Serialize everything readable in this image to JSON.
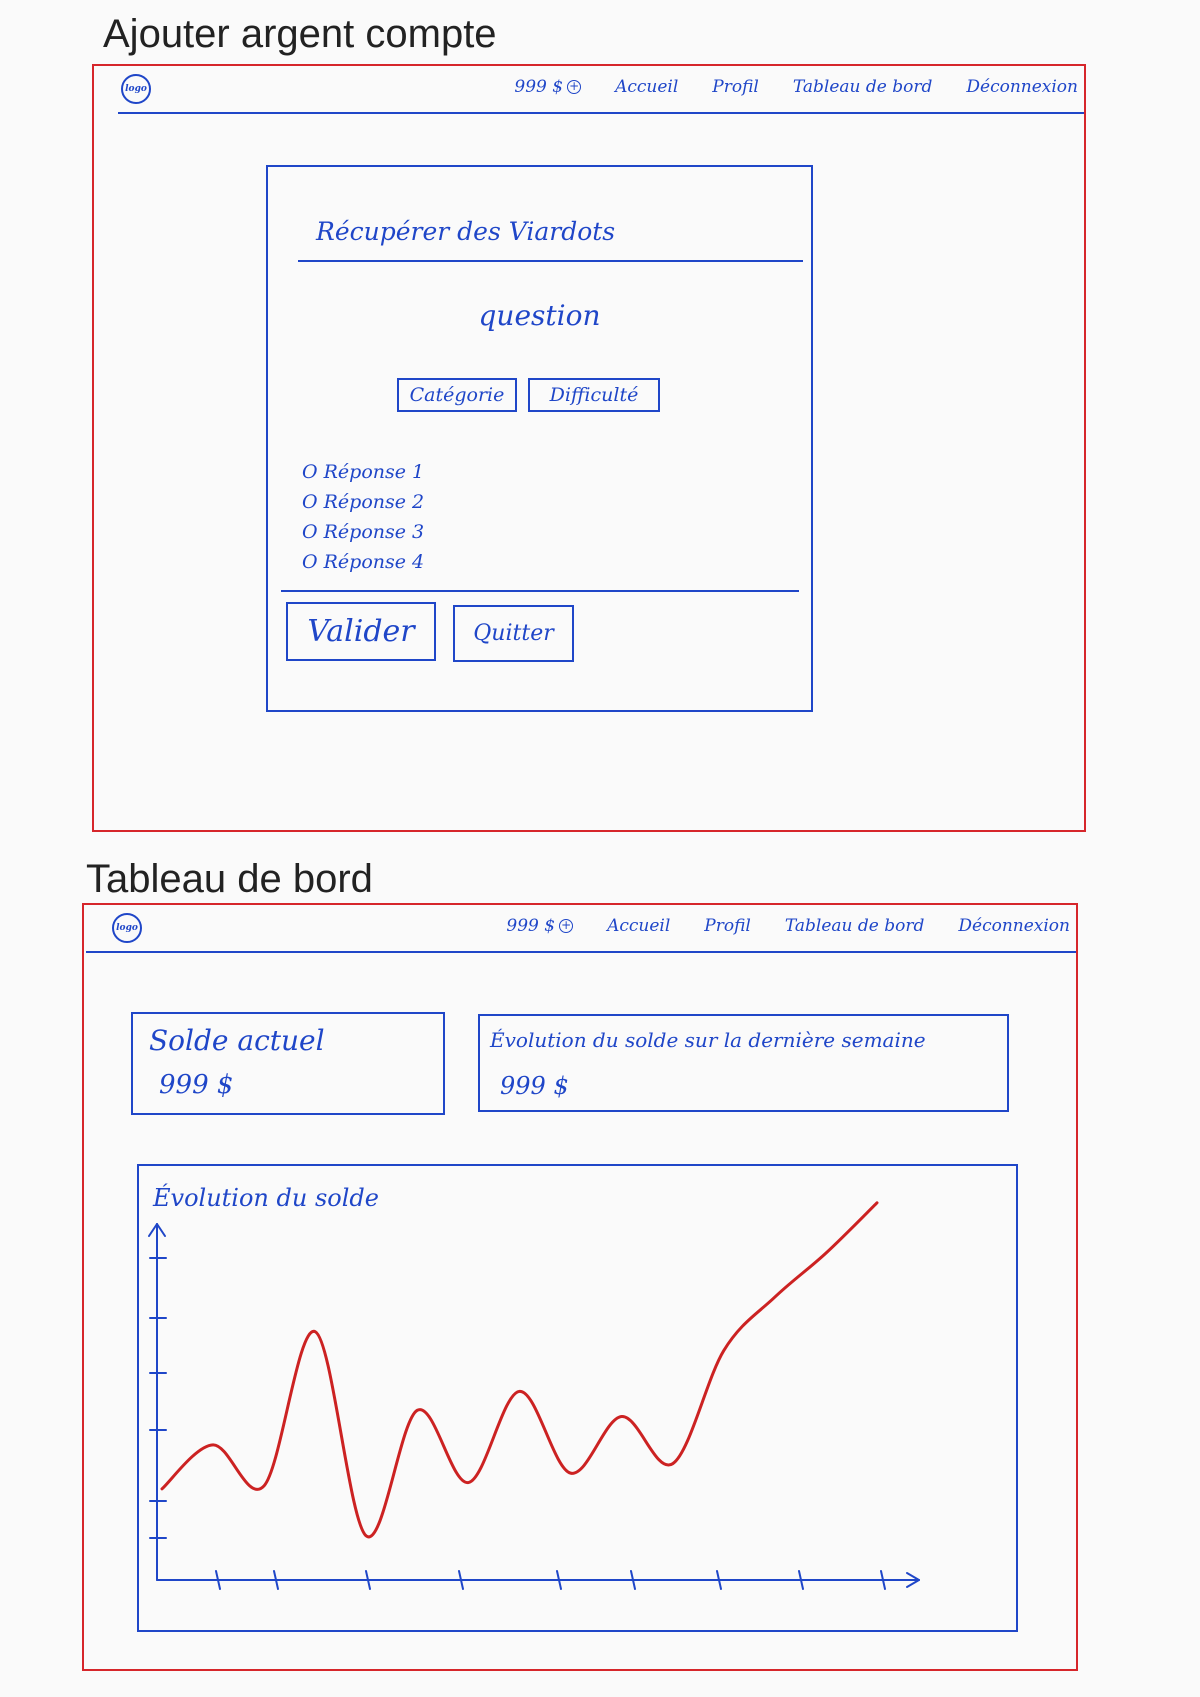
{
  "screen1": {
    "title": "Ajouter argent compte",
    "nav": {
      "logo": "logo",
      "balance": "999 $",
      "plus": "+",
      "items": [
        "Accueil",
        "Profil",
        "Tableau de bord",
        "Déconnexion"
      ]
    },
    "card": {
      "heading": "Récupérer des Viardots",
      "question": "question",
      "tags": [
        "Catégorie",
        "Difficulté"
      ],
      "answers": [
        "O Réponse 1",
        "O Réponse 2",
        "O Réponse 3",
        "O Réponse 4"
      ],
      "validate_label": "Valider",
      "quit_label": "Quitter"
    }
  },
  "screen2": {
    "title": "Tableau de bord",
    "nav": {
      "logo": "logo",
      "balance": "999 $",
      "plus": "+",
      "items": [
        "Accueil",
        "Profil",
        "Tableau de bord",
        "Déconnexion"
      ]
    },
    "current_balance": {
      "label": "Solde actuel",
      "value": "999 $"
    },
    "weekly_evolution": {
      "label": "Évolution du solde sur la dernière semaine",
      "value": "999 $"
    },
    "chart": {
      "title": "Évolution du solde"
    }
  },
  "colors": {
    "ink": "#1f46c8",
    "frame": "#d6262b",
    "curve": "#cc2222"
  },
  "chart_data": {
    "type": "line",
    "title": "Évolution du solde",
    "xlabel": "",
    "ylabel": "",
    "note": "hand-drawn sketch, no numeric labels",
    "x": [
      0,
      1,
      2,
      3,
      4,
      5,
      6,
      7,
      8,
      9,
      10,
      11,
      12,
      13,
      14
    ],
    "y": [
      29,
      43,
      30,
      79,
      14,
      54,
      31,
      60,
      34,
      52,
      37,
      73,
      90,
      104,
      120
    ]
  }
}
